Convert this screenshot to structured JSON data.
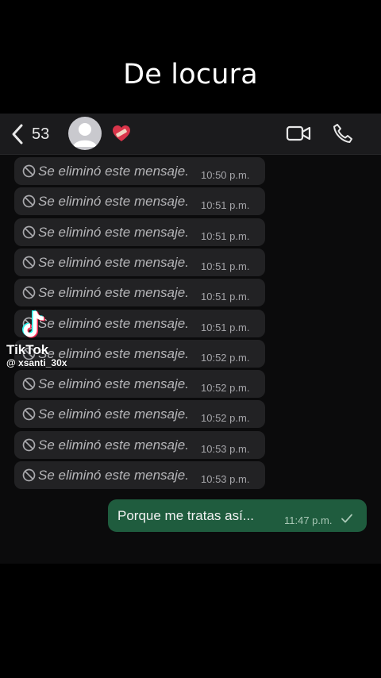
{
  "caption": "De locura",
  "header": {
    "back_count": "53",
    "contact_emoji": "heart-with-bandage",
    "accent_color": "#e8e8e8"
  },
  "messages": {
    "deleted": [
      {
        "text": "Se eliminó este mensaje.",
        "time": "10:50 p.m."
      },
      {
        "text": "Se eliminó este mensaje.",
        "time": "10:51 p.m."
      },
      {
        "text": "Se eliminó este mensaje.",
        "time": "10:51 p.m."
      },
      {
        "text": "Se eliminó este mensaje.",
        "time": "10:51 p.m."
      },
      {
        "text": "Se eliminó este mensaje.",
        "time": "10:51 p.m."
      },
      {
        "text": "Se eliminó este mensaje.",
        "time": "10:51 p.m."
      },
      {
        "text": "Se eliminó este mensaje.",
        "time": "10:52 p.m."
      },
      {
        "text": "Se eliminó este mensaje.",
        "time": "10:52 p.m."
      },
      {
        "text": "Se eliminó este mensaje.",
        "time": "10:52 p.m."
      },
      {
        "text": "Se eliminó este mensaje.",
        "time": "10:53 p.m."
      },
      {
        "text": "Se eliminó este mensaje.",
        "time": "10:53 p.m."
      }
    ],
    "outgoing": {
      "text": "Porque me tratas así...",
      "time": "11:47 p.m.",
      "status": "sent"
    }
  },
  "watermark": {
    "brand": "TikTok",
    "username": "@ xsanti_30x"
  },
  "colors": {
    "outgoing_bubble": "#1f5c3e",
    "incoming_bubble": "#222224",
    "header_bg": "#1b1b1d"
  }
}
